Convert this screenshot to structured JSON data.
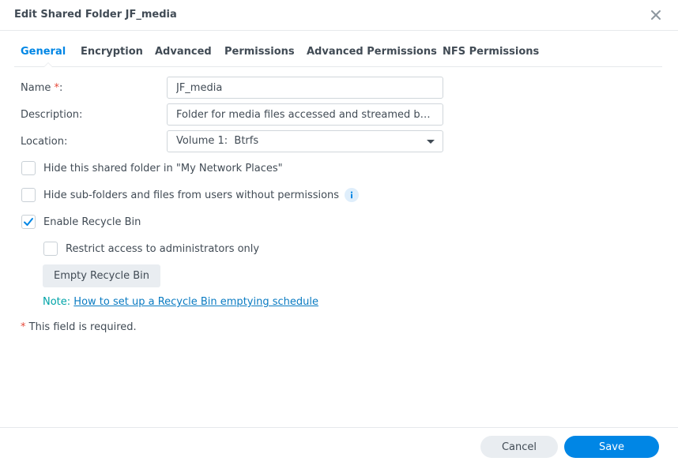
{
  "dialog": {
    "title": "Edit Shared Folder JF_media"
  },
  "tabs": [
    {
      "label": "General",
      "active": true
    },
    {
      "label": "Encryption",
      "active": false
    },
    {
      "label": "Advanced",
      "active": false
    },
    {
      "label": "Permissions",
      "active": false
    },
    {
      "label": "Advanced Permissions",
      "active": false
    },
    {
      "label": "NFS Permissions",
      "active": false
    }
  ],
  "form": {
    "name_label": "Name",
    "name_required_mark": "*",
    "name_colon": ":",
    "name_value": "JF_media",
    "description_label": "Description:",
    "description_value": "Folder for media files accessed and streamed by Jellyfin",
    "location_label": "Location:",
    "location_value": "Volume 1:  Btrfs"
  },
  "options": {
    "hide_network_places": {
      "label": "Hide this shared folder in \"My Network Places\"",
      "checked": false
    },
    "hide_subfolders": {
      "label": "Hide sub-folders and files from users without permissions",
      "checked": false
    },
    "recycle_bin": {
      "label": "Enable Recycle Bin",
      "checked": true
    },
    "restrict_admin": {
      "label": "Restrict access to administrators only",
      "checked": false
    }
  },
  "recycle": {
    "empty_button": "Empty Recycle Bin",
    "note_prefix": "Note:",
    "note_link": "How to set up a Recycle Bin emptying schedule"
  },
  "required_note": {
    "mark": "*",
    "text": "This field is required."
  },
  "footer": {
    "cancel": "Cancel",
    "save": "Save"
  },
  "colors": {
    "accent": "#0086e5",
    "required": "#e64a3b",
    "note": "#00a4a8"
  },
  "icons": {
    "close": "close-icon",
    "info": "info-icon",
    "dropdown": "chevron-down-icon",
    "check": "checkmark-icon"
  }
}
